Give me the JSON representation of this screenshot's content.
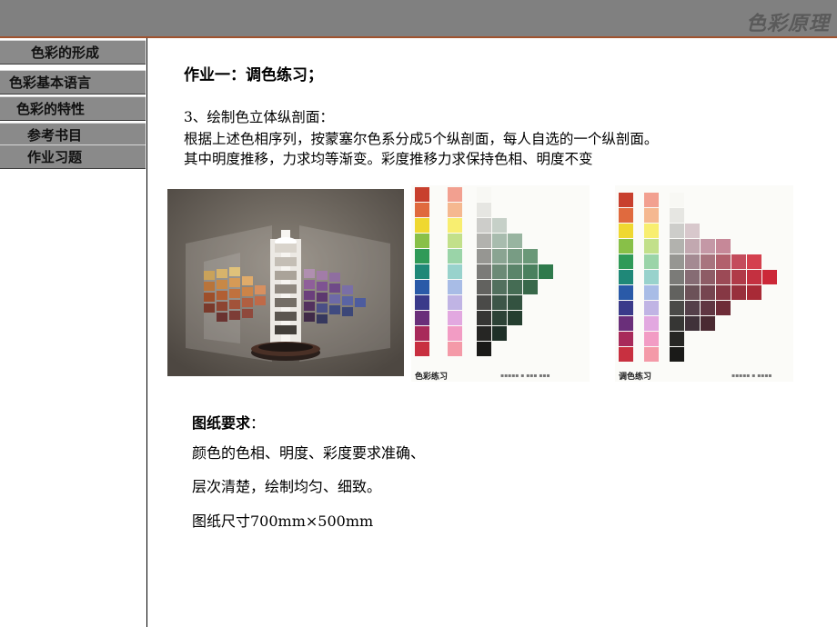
{
  "header": {
    "brand": "色彩原理"
  },
  "sidebar": {
    "items": [
      {
        "label": "色彩的形成"
      },
      {
        "label": "色彩基本语言"
      },
      {
        "label": "色彩的特性"
      },
      {
        "label": "参考书目"
      },
      {
        "label": "作业习题"
      }
    ]
  },
  "main": {
    "heading": "作业一：调色练习；",
    "line1": "3、绘制色立体纵剖面：",
    "line2": "根据上述色相序列，按蒙塞尔色系分成5个纵剖面，每人自选的一个纵剖面。",
    "line3": "其中明度推移，力求均等渐变。彩度推移力求保持色相、明度不变",
    "figure1_caption": "色彩练习",
    "figure2_caption": "调色练习",
    "requirements_title": "图纸要求",
    "requirements_colon": "：",
    "req1": "颜色的色相、明度、彩度要求准确、",
    "req2": "层次清楚，绘制均匀、细致。",
    "req3": "图纸尺寸700mm×500mm"
  },
  "colors": {
    "topbar": "#808080",
    "accent_line": "#a0522d",
    "nav_bg": "#8a8a8a"
  }
}
